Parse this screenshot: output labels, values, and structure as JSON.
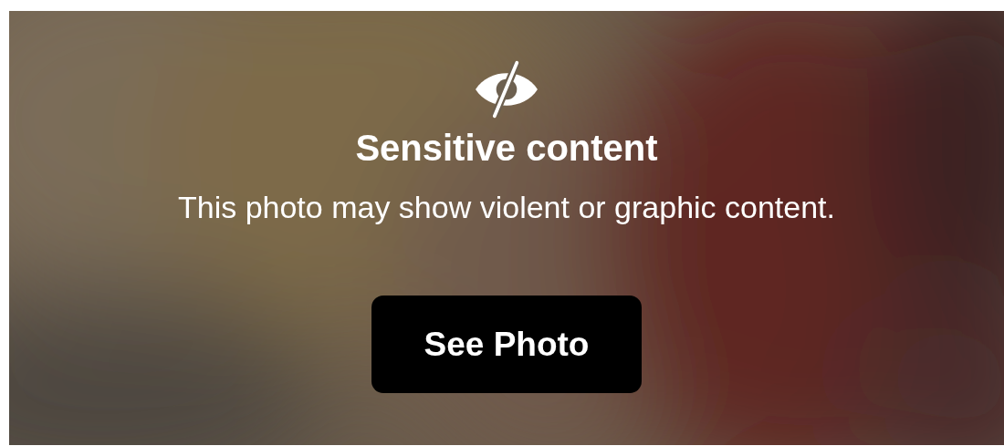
{
  "overlay": {
    "title": "Sensitive content",
    "message": "This photo may show violent or graphic content.",
    "button": "See Photo"
  }
}
